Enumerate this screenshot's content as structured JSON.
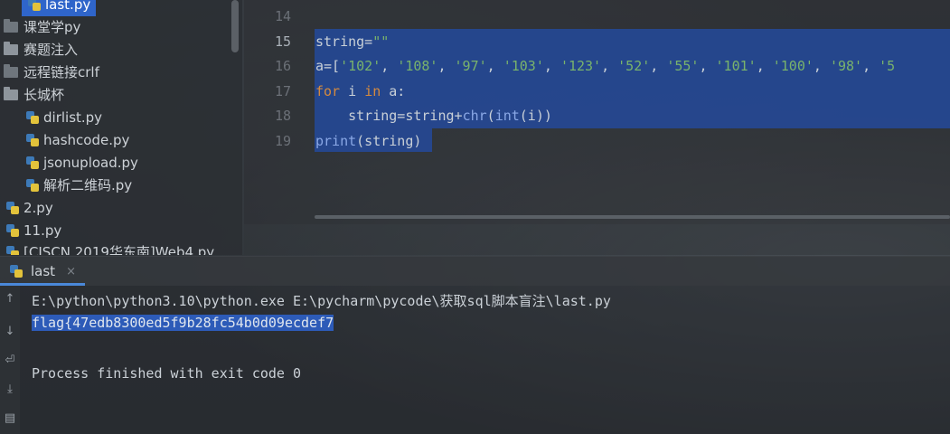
{
  "project_tree": {
    "items": [
      {
        "label": "last.py",
        "type": "python",
        "selected": true
      },
      {
        "label": "课堂学py",
        "type": "folder"
      },
      {
        "label": "赛题注入",
        "type": "folder"
      },
      {
        "label": "远程链接crlf",
        "type": "folder"
      },
      {
        "label": "长城杯",
        "type": "folder"
      },
      {
        "label": "dirlist.py",
        "type": "python"
      },
      {
        "label": "hashcode.py",
        "type": "python"
      },
      {
        "label": "jsonupload.py",
        "type": "python"
      },
      {
        "label": "解析二维码.py",
        "type": "python"
      },
      {
        "label": "2.py",
        "type": "python"
      },
      {
        "label": "11.py",
        "type": "python"
      },
      {
        "label": "[CISCN 2019华东南]Web4.py",
        "type": "python"
      }
    ]
  },
  "editor": {
    "line_numbers": [
      "14",
      "15",
      "16",
      "17",
      "18",
      "19"
    ],
    "current_line": "15",
    "lines": {
      "l15": {
        "a": "string=",
        "b": "\"\""
      },
      "l16": {
        "a": "a=[",
        "items": [
          "'102'",
          "'108'",
          "'97'",
          "'103'",
          "'123'",
          "'52'",
          "'55'",
          "'101'",
          "'100'",
          "'98'",
          "'5"
        ]
      },
      "l17": {
        "kw1": "for",
        "a": " i ",
        "kw2": "in",
        "b": " a:"
      },
      "l18": {
        "a": "    string=string+",
        "fn1": "chr",
        "b": "(",
        "fn2": "int",
        "c": "(i))"
      },
      "l19": {
        "fn": "print",
        "a": "(string)"
      }
    }
  },
  "run_panel": {
    "tab_label": "last",
    "close_glyph": "×",
    "command": "E:\\python\\python3.10\\python.exe E:\\pycharm\\pycode\\获取sql脚本盲注\\last.py",
    "output_flag": "flag{47edb8300ed5f9b28fc54b0d09ecdef7",
    "exit_message": "Process finished with exit code 0"
  },
  "icons": {
    "tool1": "up-arrow-icon",
    "tool2": "down-arrow-icon",
    "tool3": "soft-wrap-icon",
    "tool4": "scroll-to-end-icon",
    "tool5": "print-icon"
  }
}
